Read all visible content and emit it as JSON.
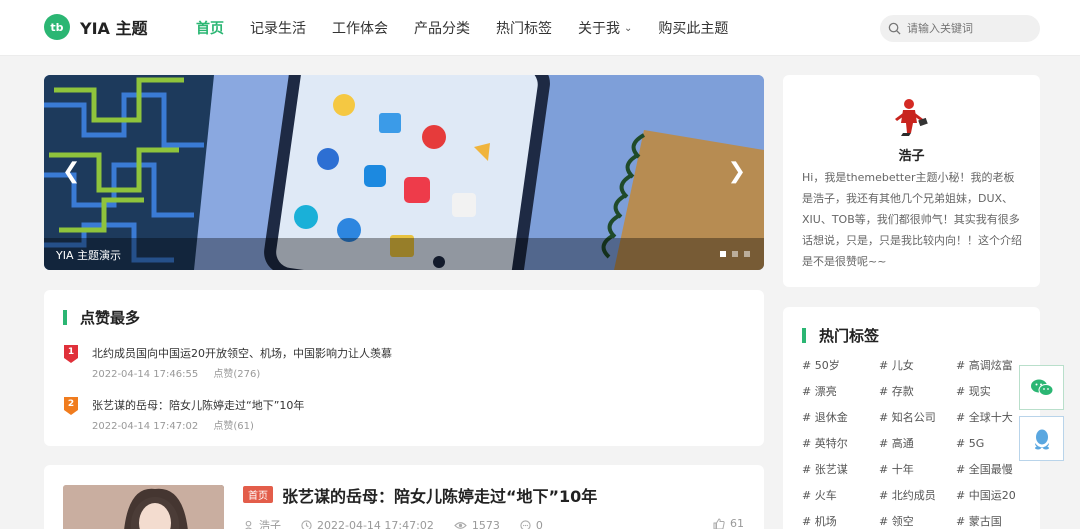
{
  "header": {
    "logo_mark": "tb",
    "site_name": "YIA 主题",
    "nav": [
      {
        "label": "首页",
        "active": true
      },
      {
        "label": "记录生活"
      },
      {
        "label": "工作体会"
      },
      {
        "label": "产品分类"
      },
      {
        "label": "热门标签"
      },
      {
        "label": "关于我",
        "dropdown": true
      },
      {
        "label": "购买此主题"
      }
    ],
    "search_placeholder": "请输入关键词"
  },
  "slider": {
    "caption": "YIA 主题演示",
    "slide_count": 3,
    "active_slide": 1
  },
  "top_likes": {
    "title": "点赞最多",
    "items": [
      {
        "rank": "1",
        "badge_color": "#e0303a",
        "title": "北约成员国向中国运20开放领空、机场，中国影响力让人羡慕",
        "date": "2022-04-14 17:46:55",
        "likes": "点赞(276)"
      },
      {
        "rank": "2",
        "badge_color": "#f07c1e",
        "title": "张艺谋的岳母：陪女儿陈婷走过“地下”10年",
        "date": "2022-04-14 17:47:02",
        "likes": "点赞(61)"
      }
    ]
  },
  "article": {
    "tag": "首页",
    "title": "张艺谋的岳母：陪女儿陈婷走过“地下”10年",
    "author": "浩子",
    "date": "2022-04-14 17:47:02",
    "views": "1573",
    "comments": "0",
    "likes": "61"
  },
  "author_card": {
    "name": "浩子",
    "bio": "Hi，我是themebetter主题小秘！我的老板是浩子，我还有其他几个兄弟姐妹，DUX、XIU、TOB等，我们都很帅气！其实我有很多话想说，只是，只是我比较内向！！这个介绍是不是很赞呢~~"
  },
  "hot_tags": {
    "title": "热门标签",
    "tags": [
      "# 50岁",
      "# 儿女",
      "# 高调炫富",
      "# 漂亮",
      "# 存款",
      "# 现实",
      "# 退休金",
      "# 知名公司",
      "# 全球十大",
      "# 英特尔",
      "# 高通",
      "# 5G",
      "# 张艺谋",
      "# 十年",
      "# 全国最慢",
      "# 火车",
      "# 北约成员",
      "# 中国运20",
      "# 机场",
      "# 领空",
      "# 蒙古国"
    ]
  },
  "colors": {
    "accent": "#2bb673",
    "tag_red": "#e35d4a"
  }
}
